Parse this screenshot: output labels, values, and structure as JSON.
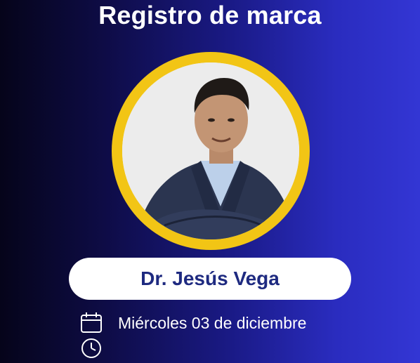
{
  "header": {
    "title": "Registro de marca"
  },
  "speaker": {
    "name": "Dr. Jesús Vega"
  },
  "details": {
    "date_text": "Miércoles 03 de diciembre",
    "date_icon": "calendar-icon",
    "time_icon": "clock-icon"
  },
  "colors": {
    "ring": "#f2c515",
    "name_text": "#1e2a80",
    "bg_left": "#05041a",
    "bg_right": "#3336d4"
  }
}
